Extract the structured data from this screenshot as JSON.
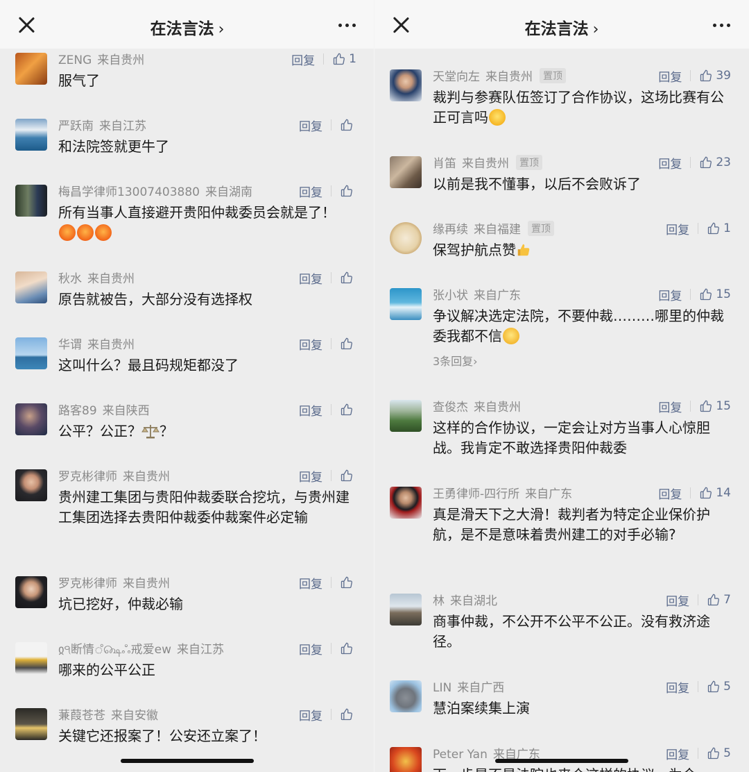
{
  "left": {
    "header": {
      "title": "在法言法",
      "title_chevron": "›"
    },
    "comments": [
      {
        "user": "ZENG",
        "loc": "来自贵州",
        "text": "服气了",
        "reply": "回复",
        "likes": "1"
      },
      {
        "user": "严跃南",
        "loc": "来自江苏",
        "text": "和法院签就更牛了",
        "reply": "回复",
        "likes": ""
      },
      {
        "user": "梅昌学律师13007403880",
        "loc": "来自湖南",
        "text": "所有当事人直接避开贵阳仲裁委员会就是了！",
        "reply": "回复",
        "likes": ""
      },
      {
        "user": "秋水",
        "loc": "来自贵州",
        "text": "原告就被告，大部分没有选择权",
        "reply": "回复",
        "likes": ""
      },
      {
        "user": "华谓",
        "loc": "来自贵州",
        "text": "这叫什么？最且码规矩都没了",
        "reply": "回复",
        "likes": ""
      },
      {
        "user": "路客89",
        "loc": "来自陕西",
        "text": "公平？公正？",
        "text_tail": "？",
        "reply": "回复",
        "likes": ""
      },
      {
        "user": "罗克彬律师",
        "loc": "来自贵州",
        "text": "贵州建工集团与贵阳仲裁委联合挖坑，与贵州建工集团选择去贵阳仲裁委仲裁案件必定输",
        "reply": "回复",
        "likes": ""
      },
      {
        "user": "罗克彬律师",
        "loc": "来自贵州",
        "text": "坑已挖好，仲裁必输",
        "reply": "回复",
        "likes": ""
      },
      {
        "user": "ჲ੧断情ஂ௸ஃ戒爱ew",
        "loc": "来自江苏",
        "text": "哪来的公平公正",
        "reply": "回复",
        "likes": ""
      },
      {
        "user": "蒹葭苍苍",
        "loc": "来自安徽",
        "text": "关键它还报案了！公安还立案了！",
        "reply": "回复",
        "likes": ""
      }
    ]
  },
  "right": {
    "header": {
      "title": "在法言法",
      "title_chevron": "›"
    },
    "pinned_label": "置顶",
    "comments": [
      {
        "user": "天堂向左",
        "loc": "来自贵州",
        "pinned": true,
        "text": "裁判与参赛队伍签订了合作协议，这场比赛有公正可言吗",
        "reply": "回复",
        "likes": "39"
      },
      {
        "user": "肖笛",
        "loc": "来自贵州",
        "pinned": true,
        "text": "以前是我不懂事，以后不会败诉了",
        "reply": "回复",
        "likes": "23"
      },
      {
        "user": "缘再续",
        "loc": "来自福建",
        "pinned": true,
        "text": "保驾护航点赞",
        "reply": "回复",
        "likes": "1"
      },
      {
        "user": "张小状",
        "loc": "来自广东",
        "text": "争议解决选定法院，不要仲裁………哪里的仲裁委我都不信",
        "reply": "回复",
        "likes": "15",
        "subreplies": "3条回复›"
      },
      {
        "user": "查俊杰",
        "loc": "来自贵州",
        "text": "这样的合作协议，一定会让对方当事人心惊胆战。我肯定不敢选择贵阳仲裁委",
        "reply": "回复",
        "likes": "15"
      },
      {
        "user": "王勇律师-四行所",
        "loc": "来自广东",
        "text": "真是滑天下之大滑！裁判者为特定企业保价护航，是不是意味着贵州建工的对手必输?",
        "reply": "回复",
        "likes": "14"
      },
      {
        "user": "林",
        "loc": "来自湖北",
        "text": "商事仲裁，不公开不公平不公正。没有救济途径。",
        "reply": "回复",
        "likes": "7"
      },
      {
        "user": "LIN",
        "loc": "来自广西",
        "text": "慧泊案续集上演",
        "reply": "回复",
        "likes": "5"
      },
      {
        "user": "Peter Yan",
        "loc": "来自广东",
        "text": "下一步是不是法院也来个这样的协议，为企",
        "reply": "回复",
        "likes": "5"
      }
    ]
  }
}
